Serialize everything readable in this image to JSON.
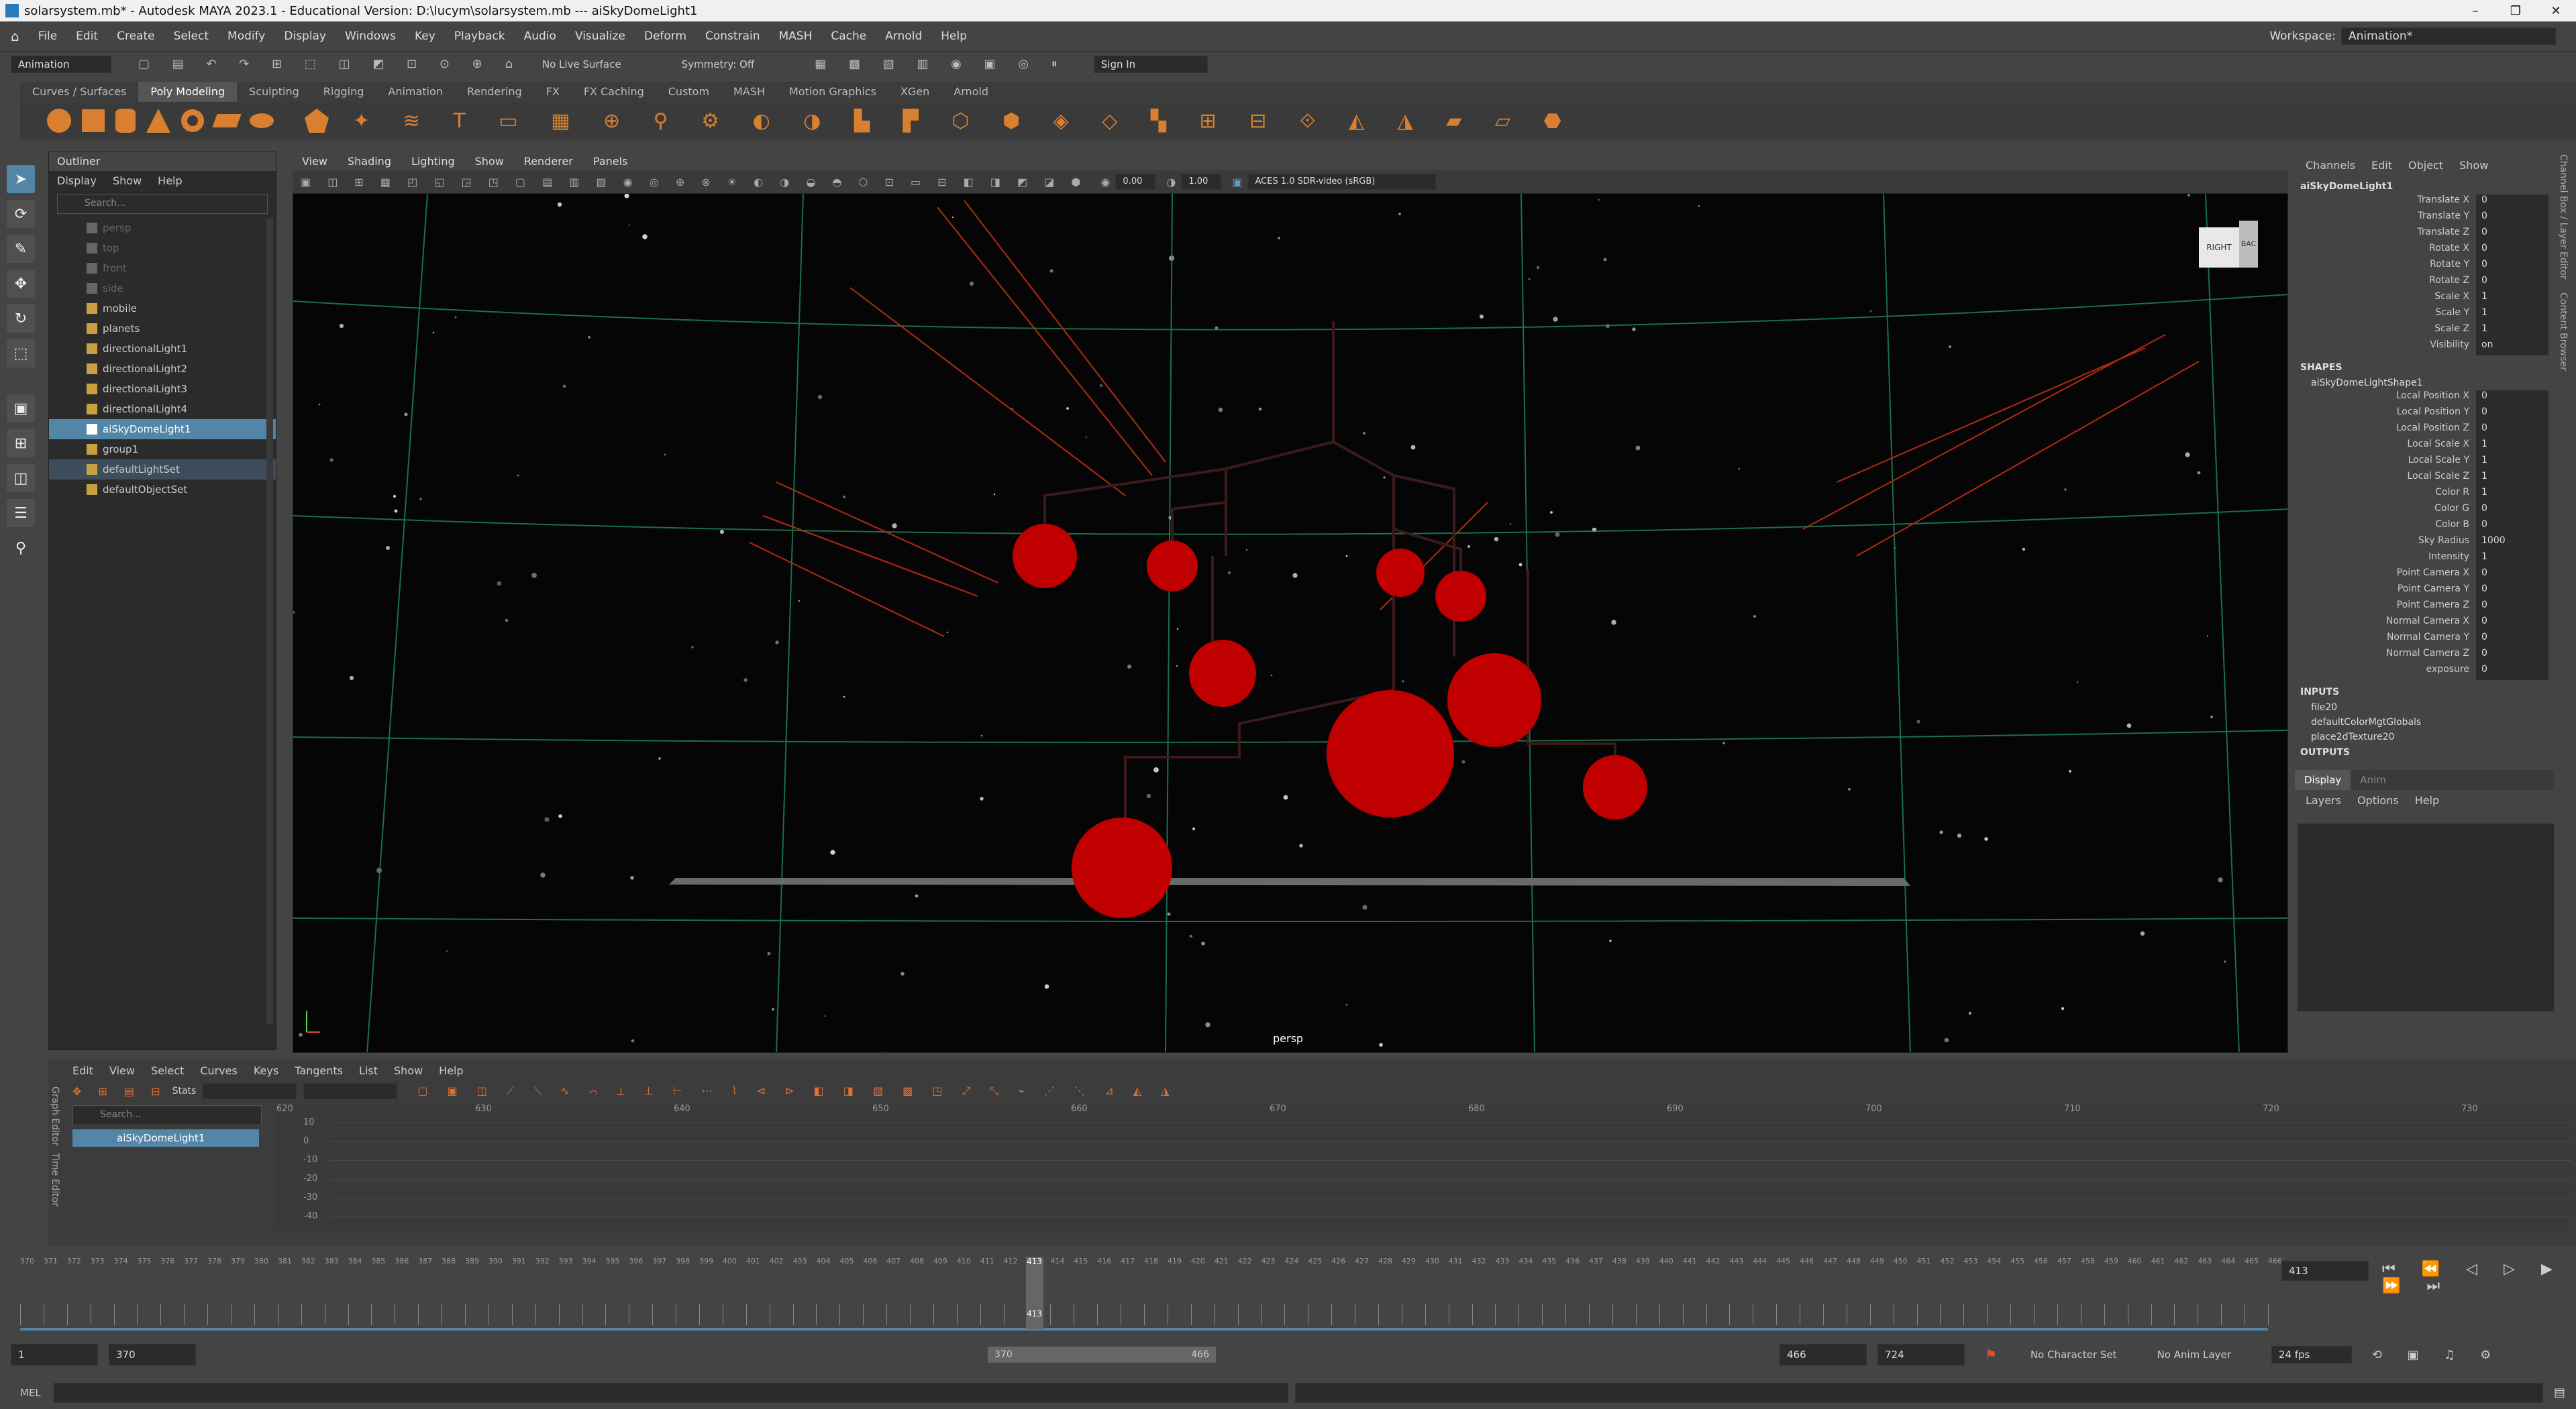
{
  "window": {
    "title": "solarsystem.mb* - Autodesk MAYA 2023.1 - Educational Version: D:\\lucym\\solarsystem.mb  ---  aiSkyDomeLight1",
    "controls": [
      "–",
      "❐",
      "✕"
    ]
  },
  "menubar": {
    "items": [
      "File",
      "Edit",
      "Create",
      "Select",
      "Modify",
      "Display",
      "Windows",
      "Key",
      "Playback",
      "Audio",
      "Visualize",
      "Deform",
      "Constrain",
      "MASH",
      "Cache",
      "Arnold",
      "Help"
    ],
    "workspace_label": "Workspace:",
    "workspace_value": "Animation*"
  },
  "statusline": {
    "menuset": "Animation",
    "live_surface": "No Live Surface",
    "symmetry": "Symmetry: Off",
    "sign_in": "Sign In"
  },
  "shelf": {
    "tabs": [
      "Curves / Surfaces",
      "Poly Modeling",
      "Sculpting",
      "Rigging",
      "Animation",
      "Rendering",
      "FX",
      "FX Caching",
      "Custom",
      "MASH",
      "Motion Graphics",
      "XGen",
      "Arnold"
    ],
    "active_tab": "Poly Modeling"
  },
  "outliner": {
    "title": "Outliner",
    "menus": [
      "Display",
      "Show",
      "Help"
    ],
    "search_placeholder": "Search...",
    "items": [
      {
        "label": "persp",
        "state": "dim"
      },
      {
        "label": "top",
        "state": "dim"
      },
      {
        "label": "front",
        "state": "dim"
      },
      {
        "label": "side",
        "state": "dim"
      },
      {
        "label": "mobile",
        "state": "normal"
      },
      {
        "label": "planets",
        "state": "normal"
      },
      {
        "label": "directionalLight1",
        "state": "normal"
      },
      {
        "label": "directionalLight2",
        "state": "normal"
      },
      {
        "label": "directionalLight3",
        "state": "normal"
      },
      {
        "label": "directionalLight4",
        "state": "normal"
      },
      {
        "label": "aiSkyDomeLight1",
        "state": "selected"
      },
      {
        "label": "group1",
        "state": "normal"
      },
      {
        "label": "defaultLightSet",
        "state": "highlight"
      },
      {
        "label": "defaultObjectSet",
        "state": "normal"
      }
    ]
  },
  "viewport": {
    "menus": [
      "View",
      "Shading",
      "Lighting",
      "Show",
      "Renderer",
      "Panels"
    ],
    "exposure": "0.00",
    "gamma": "1.00",
    "colorspace": "ACES 1.0 SDR-video (sRGB)",
    "camera_label": "persp",
    "viewcube": {
      "face_right": "RIGHT",
      "face_back": "BAC"
    }
  },
  "channelbox": {
    "menus": [
      "Channels",
      "Edit",
      "Object",
      "Show"
    ],
    "object_name": "aiSkyDomeLight1",
    "transform": [
      {
        "label": "Translate X",
        "value": "0"
      },
      {
        "label": "Translate Y",
        "value": "0"
      },
      {
        "label": "Translate Z",
        "value": "0"
      },
      {
        "label": "Rotate X",
        "value": "0"
      },
      {
        "label": "Rotate Y",
        "value": "0"
      },
      {
        "label": "Rotate Z",
        "value": "0"
      },
      {
        "label": "Scale X",
        "value": "1"
      },
      {
        "label": "Scale Y",
        "value": "1"
      },
      {
        "label": "Scale Z",
        "value": "1"
      },
      {
        "label": "Visibility",
        "value": "on"
      }
    ],
    "shapes_header": "SHAPES",
    "shape_name": "aiSkyDomeLightShape1",
    "shape": [
      {
        "label": "Local Position X",
        "value": "0"
      },
      {
        "label": "Local Position Y",
        "value": "0"
      },
      {
        "label": "Local Position Z",
        "value": "0"
      },
      {
        "label": "Local Scale X",
        "value": "1"
      },
      {
        "label": "Local Scale Y",
        "value": "1"
      },
      {
        "label": "Local Scale Z",
        "value": "1"
      },
      {
        "label": "Color R",
        "value": "1"
      },
      {
        "label": "Color G",
        "value": "0"
      },
      {
        "label": "Color B",
        "value": "0"
      },
      {
        "label": "Sky Radius",
        "value": "1000"
      },
      {
        "label": "Intensity",
        "value": "1"
      },
      {
        "label": "Point Camera X",
        "value": "0"
      },
      {
        "label": "Point Camera Y",
        "value": "0"
      },
      {
        "label": "Point Camera Z",
        "value": "0"
      },
      {
        "label": "Normal Camera X",
        "value": "0"
      },
      {
        "label": "Normal Camera Y",
        "value": "0"
      },
      {
        "label": "Normal Camera Z",
        "value": "0"
      },
      {
        "label": "exposure",
        "value": "0"
      }
    ],
    "inputs_header": "INPUTS",
    "inputs": [
      "file20",
      "defaultColorMgtGlobals",
      "place2dTexture20"
    ],
    "outputs_header": "OUTPUTS",
    "layer_tabs": [
      "Display",
      "Anim"
    ],
    "layer_menus": [
      "Layers",
      "Options",
      "Help"
    ],
    "side_tabs": [
      "Channel Box / Layer Editor",
      "Content Browser"
    ]
  },
  "grapheditor": {
    "menus": [
      "Edit",
      "View",
      "Select",
      "Curves",
      "Keys",
      "Tangents",
      "List",
      "Show",
      "Help"
    ],
    "stats_label": "Stats",
    "search_placeholder": "Search...",
    "item": "aiSkyDomeLight1",
    "x_ticks": [
      "620",
      "630",
      "640",
      "650",
      "660",
      "670",
      "680",
      "690",
      "700",
      "710",
      "720",
      "730"
    ],
    "y_ticks": [
      "10",
      "0",
      "-10",
      "-20",
      "-30",
      "-40"
    ],
    "side_labels": [
      "Graph Editor",
      "Time Editor"
    ]
  },
  "timeslider": {
    "start_frame": 370,
    "end_frame": 466,
    "current_frame": "413",
    "current_field": "413"
  },
  "rangebar": {
    "start": "1",
    "range_start": "370",
    "slider_start": "370",
    "slider_end": "466",
    "range_end": "466",
    "end": "724",
    "character_set": "No Character Set",
    "anim_layer": "No Anim Layer",
    "fps": "24 fps"
  },
  "cmdline": {
    "label": "MEL"
  },
  "colors": {
    "selection": "#5285a6",
    "planet": "#cc0000",
    "grid": "#1f8a5e",
    "key": "#e07030"
  }
}
